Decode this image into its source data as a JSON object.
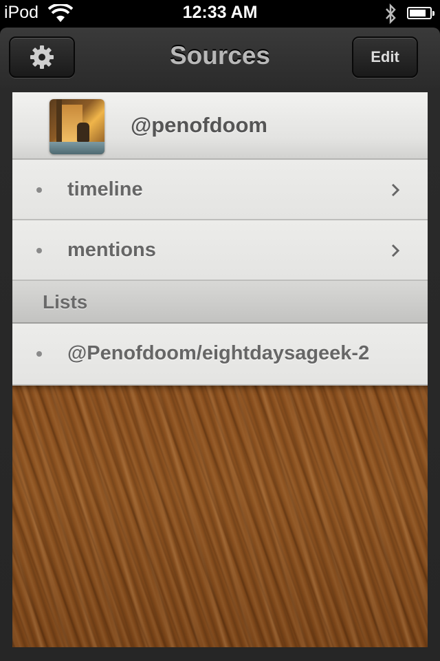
{
  "status_bar": {
    "carrier": "iPod",
    "time": "12:33 AM",
    "battery_level": 0.8
  },
  "navbar": {
    "title": "Sources",
    "edit_label": "Edit",
    "settings_icon": "gear-icon"
  },
  "account": {
    "name": "@penofdoom"
  },
  "rows": [
    {
      "label": "timeline",
      "has_chevron": true
    },
    {
      "label": "mentions",
      "has_chevron": true
    }
  ],
  "lists_section": {
    "title": "Lists",
    "items": [
      {
        "label": "@Penofdoom/eightdaysageek-2"
      }
    ]
  },
  "colors": {
    "status_bar_bg": "#000000",
    "nav_bg": "#2a2a2a",
    "row_bg": "#e8e8e6",
    "text": "#666666",
    "wood": "#8a4f1e"
  }
}
